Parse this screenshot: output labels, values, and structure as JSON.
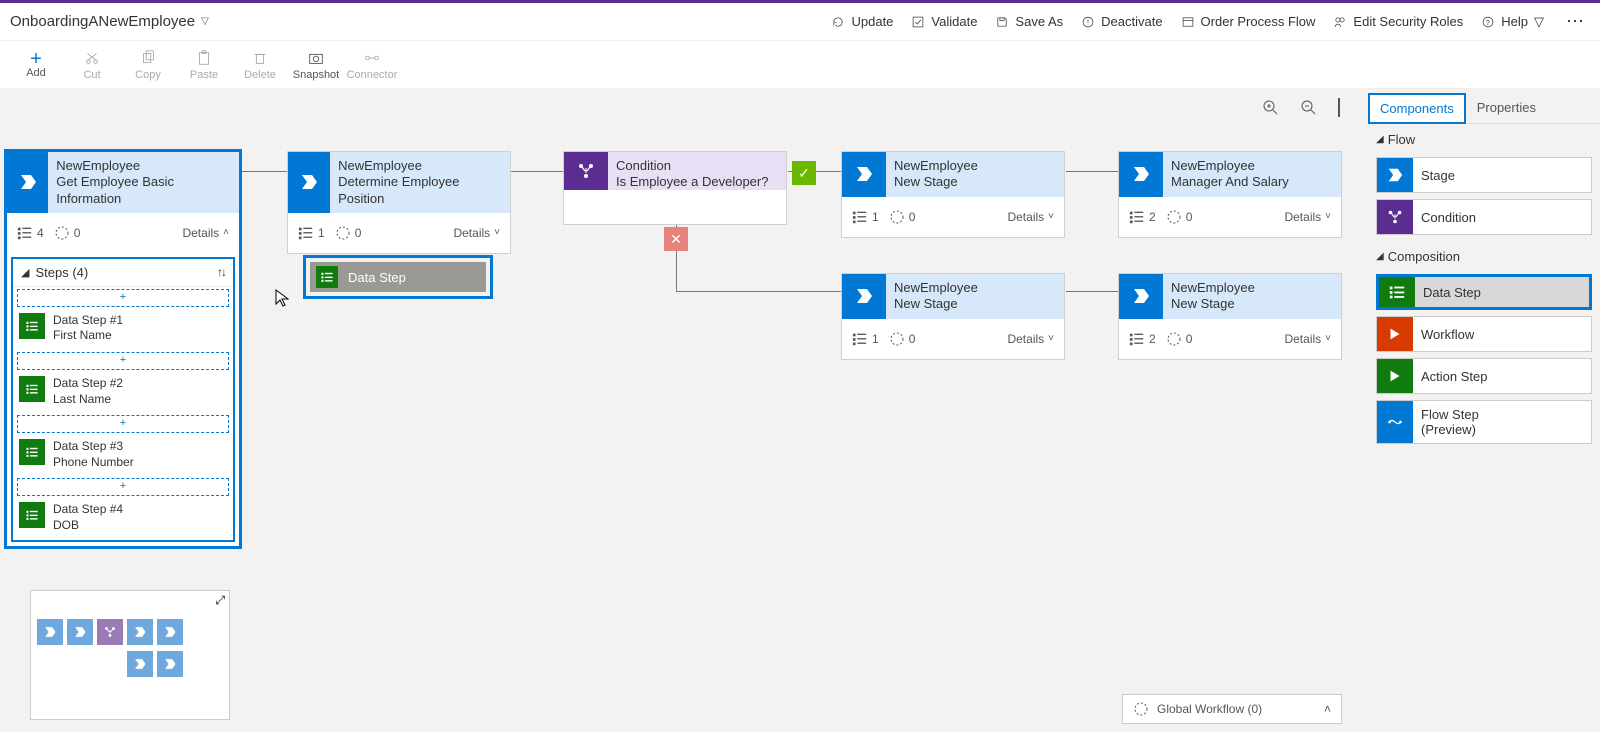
{
  "header": {
    "process_name": "OnboardingANewEmployee",
    "commands": {
      "update": "Update",
      "validate": "Validate",
      "save_as": "Save As",
      "deactivate": "Deactivate",
      "order": "Order Process Flow",
      "security": "Edit Security Roles",
      "help": "Help"
    }
  },
  "toolbar": {
    "add": "Add",
    "cut": "Cut",
    "copy": "Copy",
    "paste": "Paste",
    "delete": "Delete",
    "snapshot": "Snapshot",
    "connector": "Connector"
  },
  "right_panel": {
    "tabs": {
      "components": "Components",
      "properties": "Properties"
    },
    "sections": {
      "flow": "Flow",
      "composition": "Composition"
    },
    "items": {
      "stage": "Stage",
      "condition": "Condition",
      "data_step": "Data Step",
      "workflow": "Workflow",
      "action_step": "Action Step",
      "flow_step": "Flow Step\n(Preview)"
    }
  },
  "canvas": {
    "tiles": {
      "t1": {
        "entity": "NewEmployee",
        "name": "Get Employee Basic Information",
        "steps_count": "4",
        "wf_count": "0",
        "details": "Details"
      },
      "t2": {
        "entity": "NewEmployee",
        "name": "Determine Employee Position",
        "steps_count": "1",
        "wf_count": "0",
        "details": "Details"
      },
      "cond": {
        "entity": "Condition",
        "name": "Is Employee a Developer?"
      },
      "t4": {
        "entity": "NewEmployee",
        "name": "New Stage",
        "steps_count": "1",
        "wf_count": "0",
        "details": "Details"
      },
      "t5": {
        "entity": "NewEmployee",
        "name": "Manager And Salary",
        "steps_count": "2",
        "wf_count": "0",
        "details": "Details"
      },
      "t6": {
        "entity": "NewEmployee",
        "name": "New Stage",
        "steps_count": "1",
        "wf_count": "0",
        "details": "Details"
      },
      "t7": {
        "entity": "NewEmployee",
        "name": "New Stage",
        "steps_count": "2",
        "wf_count": "0",
        "details": "Details"
      }
    },
    "steps_panel": {
      "header": "Steps (4)",
      "items": [
        {
          "title": "Data Step #1",
          "field": "First Name"
        },
        {
          "title": "Data Step #2",
          "field": "Last Name"
        },
        {
          "title": "Data Step #3",
          "field": "Phone Number"
        },
        {
          "title": "Data Step #4",
          "field": "DOB"
        }
      ]
    },
    "drag_label": "Data Step"
  },
  "footer": {
    "global_workflow": "Global Workflow (0)"
  }
}
